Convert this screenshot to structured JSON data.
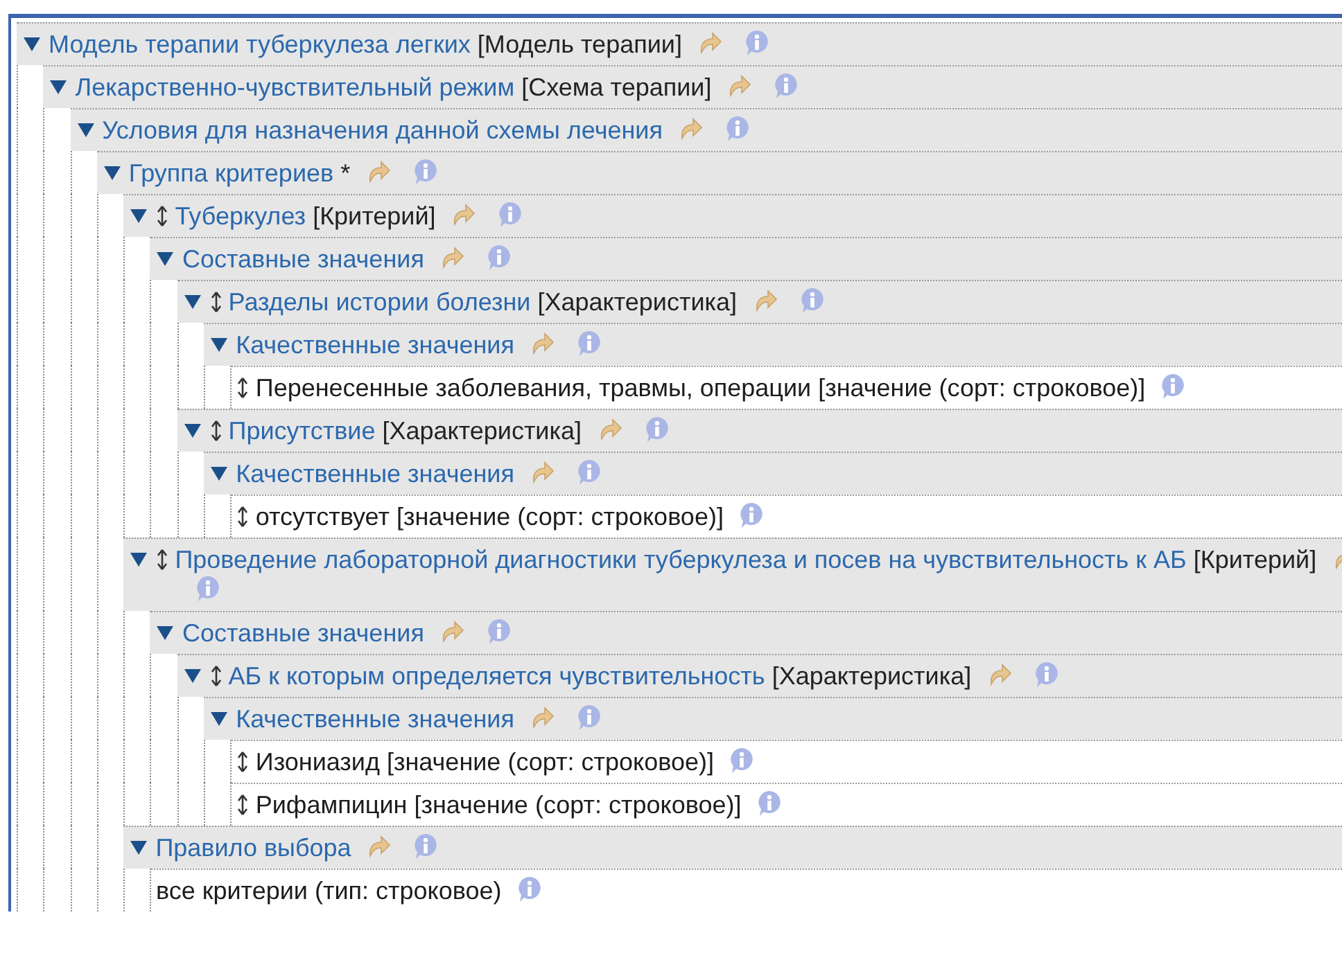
{
  "tree": [
    {
      "kind": "section",
      "name": "Модель терапии туберкулеза легких",
      "type": "[Модель терапии]",
      "expanded": true,
      "movable": false,
      "children": [
        {
          "kind": "section",
          "name": "Лекарственно-чувствительный режим",
          "type": "[Схема терапии]",
          "expanded": true,
          "movable": false,
          "children": [
            {
              "kind": "section",
              "name": "Условия для назначения данной схемы лечения",
              "expanded": true,
              "movable": false,
              "children": [
                {
                  "kind": "section",
                  "name": "Группа критериев",
                  "type": "*",
                  "expanded": true,
                  "movable": false,
                  "children": [
                    {
                      "kind": "section",
                      "name": "Туберкулез",
                      "type": "[Критерий]",
                      "expanded": true,
                      "movable": true,
                      "children": [
                        {
                          "kind": "section",
                          "name": "Составные значения",
                          "expanded": true,
                          "movable": false,
                          "children": [
                            {
                              "kind": "section",
                              "name": "Разделы истории болезни",
                              "type": "[Характеристика]",
                              "expanded": true,
                              "movable": true,
                              "children": [
                                {
                                  "kind": "section",
                                  "name": "Качественные значения",
                                  "expanded": true,
                                  "movable": false,
                                  "children": [
                                    {
                                      "kind": "leaf",
                                      "text": "Перенесенные заболевания, травмы, операции [значение (сорт: строковое)]",
                                      "movable": true
                                    }
                                  ]
                                }
                              ]
                            },
                            {
                              "kind": "section",
                              "name": "Присутствие",
                              "type": "[Характеристика]",
                              "expanded": true,
                              "movable": true,
                              "children": [
                                {
                                  "kind": "section",
                                  "name": "Качественные значения",
                                  "expanded": true,
                                  "movable": false,
                                  "children": [
                                    {
                                      "kind": "leaf",
                                      "text": "отсутствует [значение (сорт: строковое)]",
                                      "movable": true
                                    }
                                  ]
                                }
                              ]
                            }
                          ]
                        }
                      ]
                    },
                    {
                      "kind": "section",
                      "name": "Проведение лабораторной диагностики туберкулеза и посев на чувствительность к АБ",
                      "type": "[Критерий]",
                      "expanded": true,
                      "movable": true,
                      "children": [
                        {
                          "kind": "section",
                          "name": "Составные значения",
                          "expanded": true,
                          "movable": false,
                          "children": [
                            {
                              "kind": "section",
                              "name": "АБ к которым определяется чувствительность",
                              "type": "[Характеристика]",
                              "expanded": true,
                              "movable": true,
                              "children": [
                                {
                                  "kind": "section",
                                  "name": "Качественные значения",
                                  "expanded": true,
                                  "movable": false,
                                  "children": [
                                    {
                                      "kind": "leaf",
                                      "text": "Изониазид [значение (сорт: строковое)]",
                                      "movable": true
                                    },
                                    {
                                      "kind": "leaf",
                                      "text": "Рифампицин [значение (сорт: строковое)]",
                                      "movable": true
                                    }
                                  ]
                                }
                              ]
                            }
                          ]
                        }
                      ]
                    },
                    {
                      "kind": "section",
                      "name": "Правило выбора",
                      "expanded": true,
                      "movable": false,
                      "children": [
                        {
                          "kind": "leaf",
                          "text": "все критерии (тип: строковое)",
                          "movable": false
                        }
                      ]
                    }
                  ]
                }
              ]
            }
          ]
        }
      ]
    }
  ]
}
